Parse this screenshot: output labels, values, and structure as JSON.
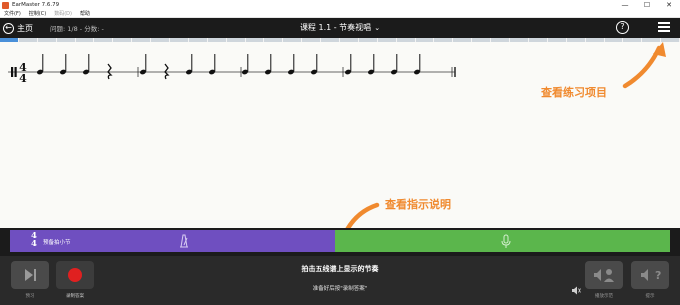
{
  "window": {
    "title": "EarMaster 7.6.79",
    "minimize": "—",
    "maximize": "☐",
    "close": "✕"
  },
  "menu": [
    "文件(F)",
    "控制(C)",
    "数码(D)",
    "帮助"
  ],
  "toolbar": {
    "home_label": "主页",
    "question_info": "问题: 1/8 - 分数: -",
    "lesson_title": "课程 1.1 - 节奏视唱"
  },
  "progress": {
    "segments": 36,
    "completed": 1
  },
  "score": {
    "time_signature": {
      "top": "4",
      "bottom": "4"
    },
    "measures": [
      [
        "quarter",
        "quarter",
        "quarter",
        "rest"
      ],
      [
        "quarter",
        "rest",
        "quarter",
        "quarter"
      ],
      [
        "quarter",
        "quarter",
        "quarter",
        "quarter"
      ],
      [
        "quarter",
        "quarter",
        "quarter",
        "quarter"
      ]
    ]
  },
  "callouts": {
    "practice_items": "查看练习项目",
    "instructions": "查看指示说明"
  },
  "status": {
    "time_signature": {
      "top": "4",
      "bottom": "4"
    },
    "count_in_label": "预备拍小节",
    "colors": {
      "count_in": "#6f4fc0",
      "record": "#5bb64c"
    }
  },
  "bottom": {
    "play_label": "预习",
    "record_label": "录制答案",
    "instruction": "拍击五线谱上显示的节奏",
    "sub_instruction": "准备好后按\"录制答案\"",
    "hear_label": "播放示范",
    "hint_label": "提示"
  },
  "accent_color": "#f08a2f"
}
